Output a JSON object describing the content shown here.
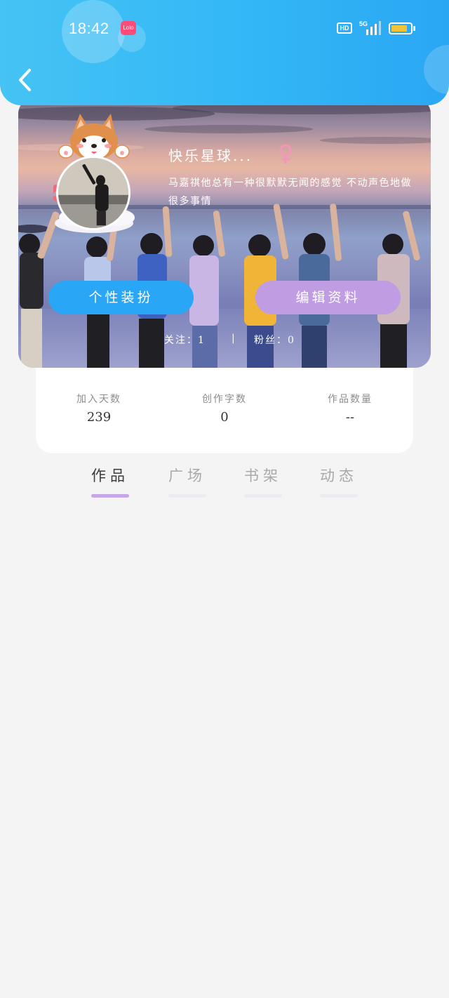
{
  "status_bar": {
    "time": "18:42",
    "app_badge": "Lolo",
    "hd_label": "HD",
    "network_label": "5G",
    "battery_color": "#f1c437"
  },
  "header": {
    "back_icon": "chevron-left-icon",
    "gradient_colors": [
      "#45c3f4",
      "#2aa7f3"
    ]
  },
  "profile": {
    "nickname": "快乐星球...",
    "gender_icon": "female-icon",
    "gender_color": "#f497b6",
    "bio": "马嘉祺他总有一种很默默无闻的感觉 不动声色地做很多事情",
    "buttons": {
      "dress_up": "个性装扮",
      "edit_profile": "编辑资料"
    },
    "follow": {
      "following": "关注：1",
      "separator": "|",
      "fans": "粉丝：0"
    }
  },
  "stats": [
    {
      "label": "加入天数",
      "value": "239"
    },
    {
      "label": "创作字数",
      "value": "0"
    },
    {
      "label": "作品数量",
      "value": "--"
    }
  ],
  "tabs": [
    {
      "label": "作品",
      "active": true
    },
    {
      "label": "广场",
      "active": false
    },
    {
      "label": "书架",
      "active": false
    },
    {
      "label": "动态",
      "active": false
    }
  ],
  "colors": {
    "accent_blue": "#2aa6f6",
    "accent_purple": "#c09ce3",
    "tab_indicator": "#c4a7e4",
    "page_background": "#f5f4f5"
  }
}
